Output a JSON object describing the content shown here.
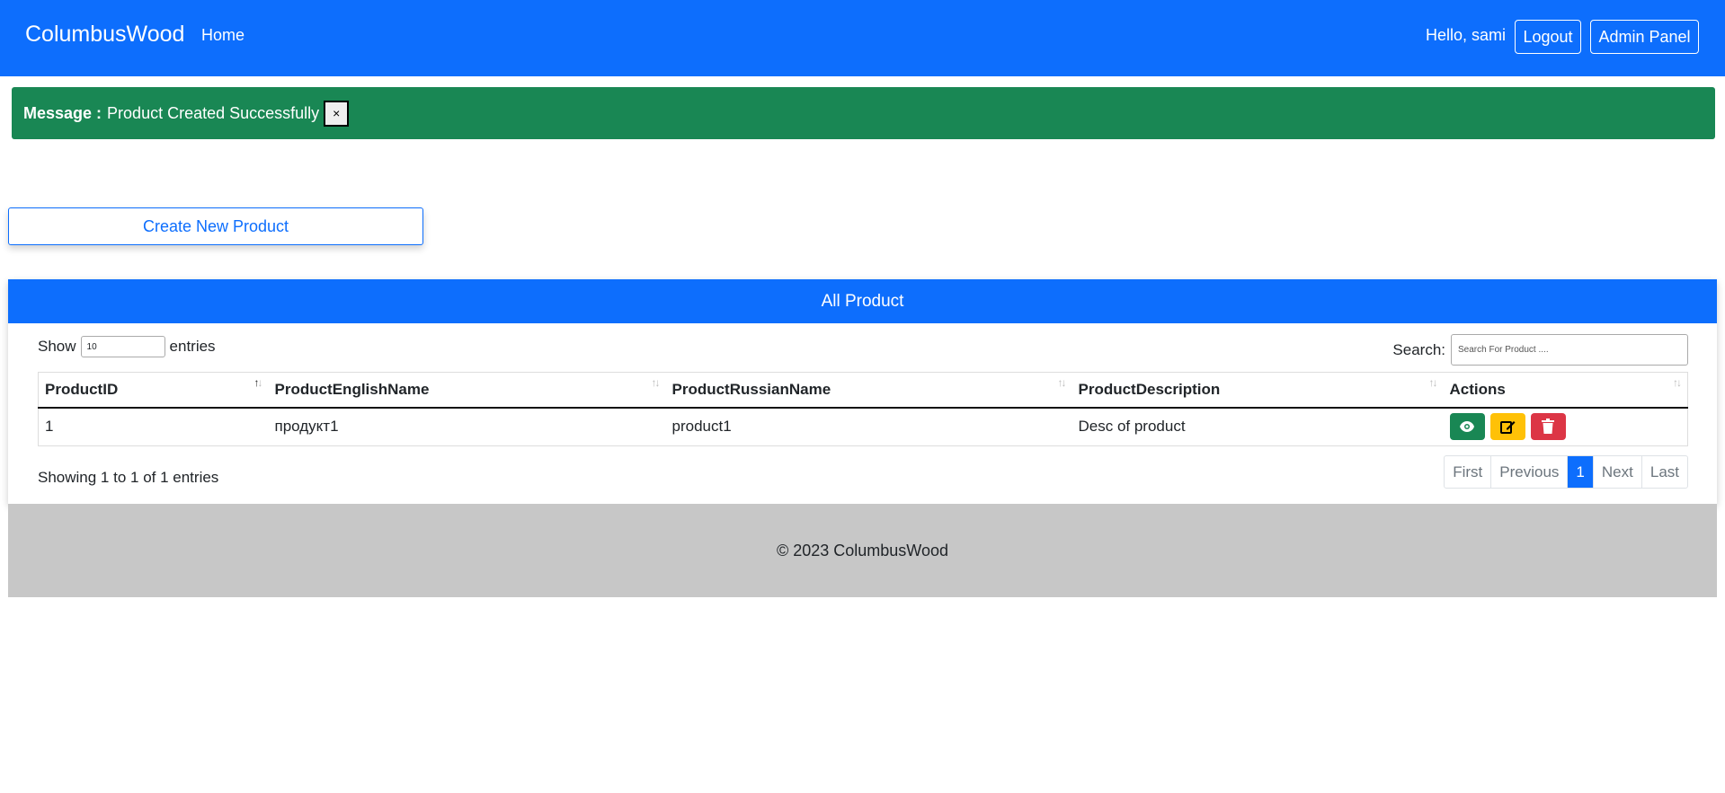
{
  "navbar": {
    "brand": "ColumbusWood",
    "home": "Home",
    "greeting": "Hello, sami",
    "logout": "Logout",
    "admin_panel": "Admin Panel",
    "color": "#0d6efd"
  },
  "alert": {
    "label": "Message :",
    "text": "Product Created Successfully",
    "close": "×",
    "color": "#198754"
  },
  "create_button": "Create New Product",
  "card": {
    "title": "All Product",
    "show_label": "Show",
    "show_value": "10",
    "entries_label": "entries",
    "search_label": "Search:",
    "search_placeholder": "Search For Product ....",
    "columns": [
      "ProductID",
      "ProductEnglishName",
      "ProductRussianName",
      "ProductDescription",
      "Actions"
    ],
    "rows": [
      {
        "id": "1",
        "english": "продукт1",
        "russian": "product1",
        "description": "Desc of product"
      }
    ],
    "info": "Showing 1 to 1 of 1 entries",
    "pagination": {
      "first": "First",
      "previous": "Previous",
      "current": "1",
      "next": "Next",
      "last": "Last"
    },
    "action_icons": [
      "eye-icon",
      "edit-icon",
      "trash-icon"
    ]
  },
  "footer": "© 2023 ColumbusWood"
}
